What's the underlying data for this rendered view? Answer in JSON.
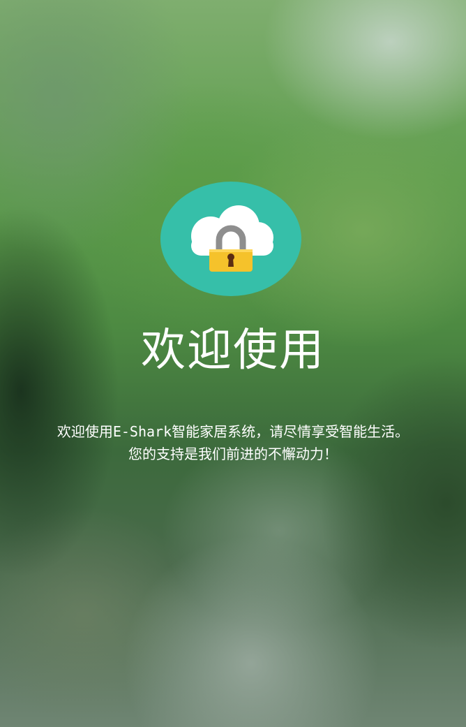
{
  "welcome": {
    "title": "欢迎使用",
    "description_line1": "欢迎使用E-Shark智能家居系统，请尽情享受智能生活。",
    "description_line2": "您的支持是我们前进的不懈动力！"
  },
  "logo": {
    "icon": "cloud-lock-icon",
    "circle_color": "#36bfa9",
    "lock_color": "#f5c22b"
  }
}
